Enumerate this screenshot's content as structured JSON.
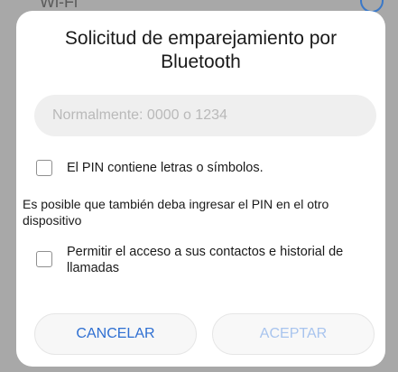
{
  "background": {
    "status_text": "Wi-Fi",
    "icon": "info-icon"
  },
  "dialog": {
    "title": "Solicitud de emparejamiento por Bluetooth",
    "pin_input": {
      "value": "",
      "placeholder": "Normalmente: 0000 o 1234"
    },
    "checkbox_pin_letters": {
      "label": "El PIN contiene letras o símbolos.",
      "checked": false
    },
    "info_text": "Es posible que también deba ingresar el PIN en el otro dispositivo",
    "checkbox_contacts": {
      "label": "Permitir el acceso a sus contactos e historial de llamadas",
      "checked": false
    },
    "buttons": {
      "cancel": "CANCELAR",
      "accept": "ACEPTAR"
    },
    "colors": {
      "accent": "#2e6fd2",
      "accent_disabled": "#a8c4ee"
    }
  }
}
